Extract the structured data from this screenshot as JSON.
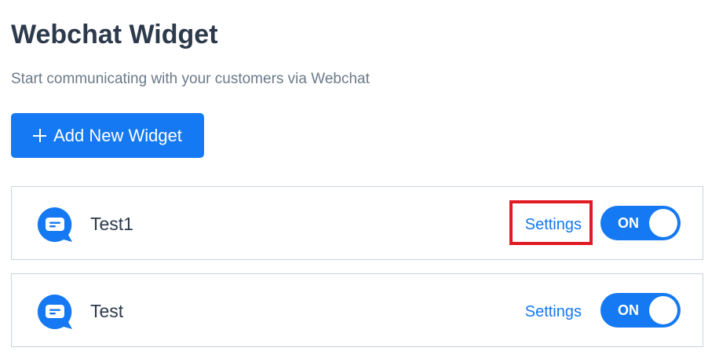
{
  "header": {
    "title": "Webchat Widget",
    "subtitle": "Start communicating with your customers via Webchat"
  },
  "actions": {
    "add_label": "Add New Widget",
    "add_icon": "plus-icon"
  },
  "widgets": [
    {
      "name": "Test1",
      "settings_label": "Settings",
      "toggle_label": "ON",
      "enabled": true,
      "icon": "chat-bubble-icon",
      "settings_highlighted": true
    },
    {
      "name": "Test",
      "settings_label": "Settings",
      "toggle_label": "ON",
      "enabled": true,
      "icon": "chat-bubble-icon",
      "settings_highlighted": false
    }
  ],
  "colors": {
    "accent": "#1479f2",
    "title": "#2c3a4b",
    "subtitle": "#6b7a89",
    "border": "#c9d3dc",
    "highlight": "#e01b24"
  }
}
